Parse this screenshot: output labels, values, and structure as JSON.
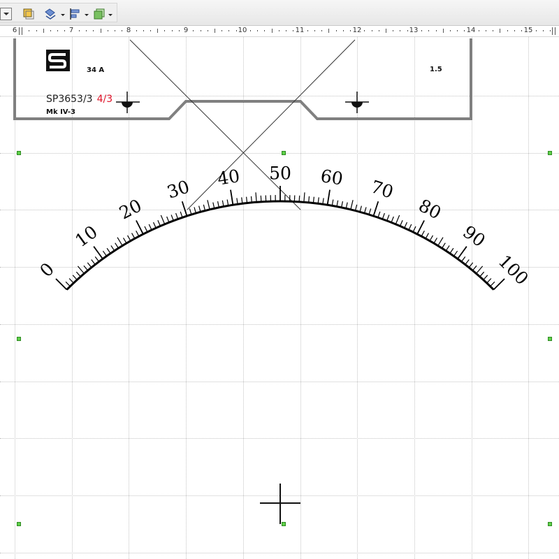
{
  "toolbar": {
    "icons": [
      "dropdown-icon",
      "fill-color-icon",
      "line-style-icon",
      "align-icon",
      "arrange-icon"
    ]
  },
  "ruler": {
    "labels": [
      "6",
      "7",
      "8",
      "9",
      "10",
      "11",
      "12",
      "13",
      "14",
      "15"
    ]
  },
  "meter_panel": {
    "logo_text": "S",
    "current_rating": "34 A",
    "accuracy_class": "1.5",
    "part_number": "SP3653/3",
    "part_suffix": "4/3",
    "model": "Mk IV-3",
    "accent_color": "#e0142a"
  },
  "scale": {
    "labels": [
      "0",
      "10",
      "20",
      "30",
      "40",
      "50",
      "60",
      "70",
      "80",
      "90",
      "100"
    ],
    "min": 0,
    "max": 100,
    "minor_step": 1
  }
}
